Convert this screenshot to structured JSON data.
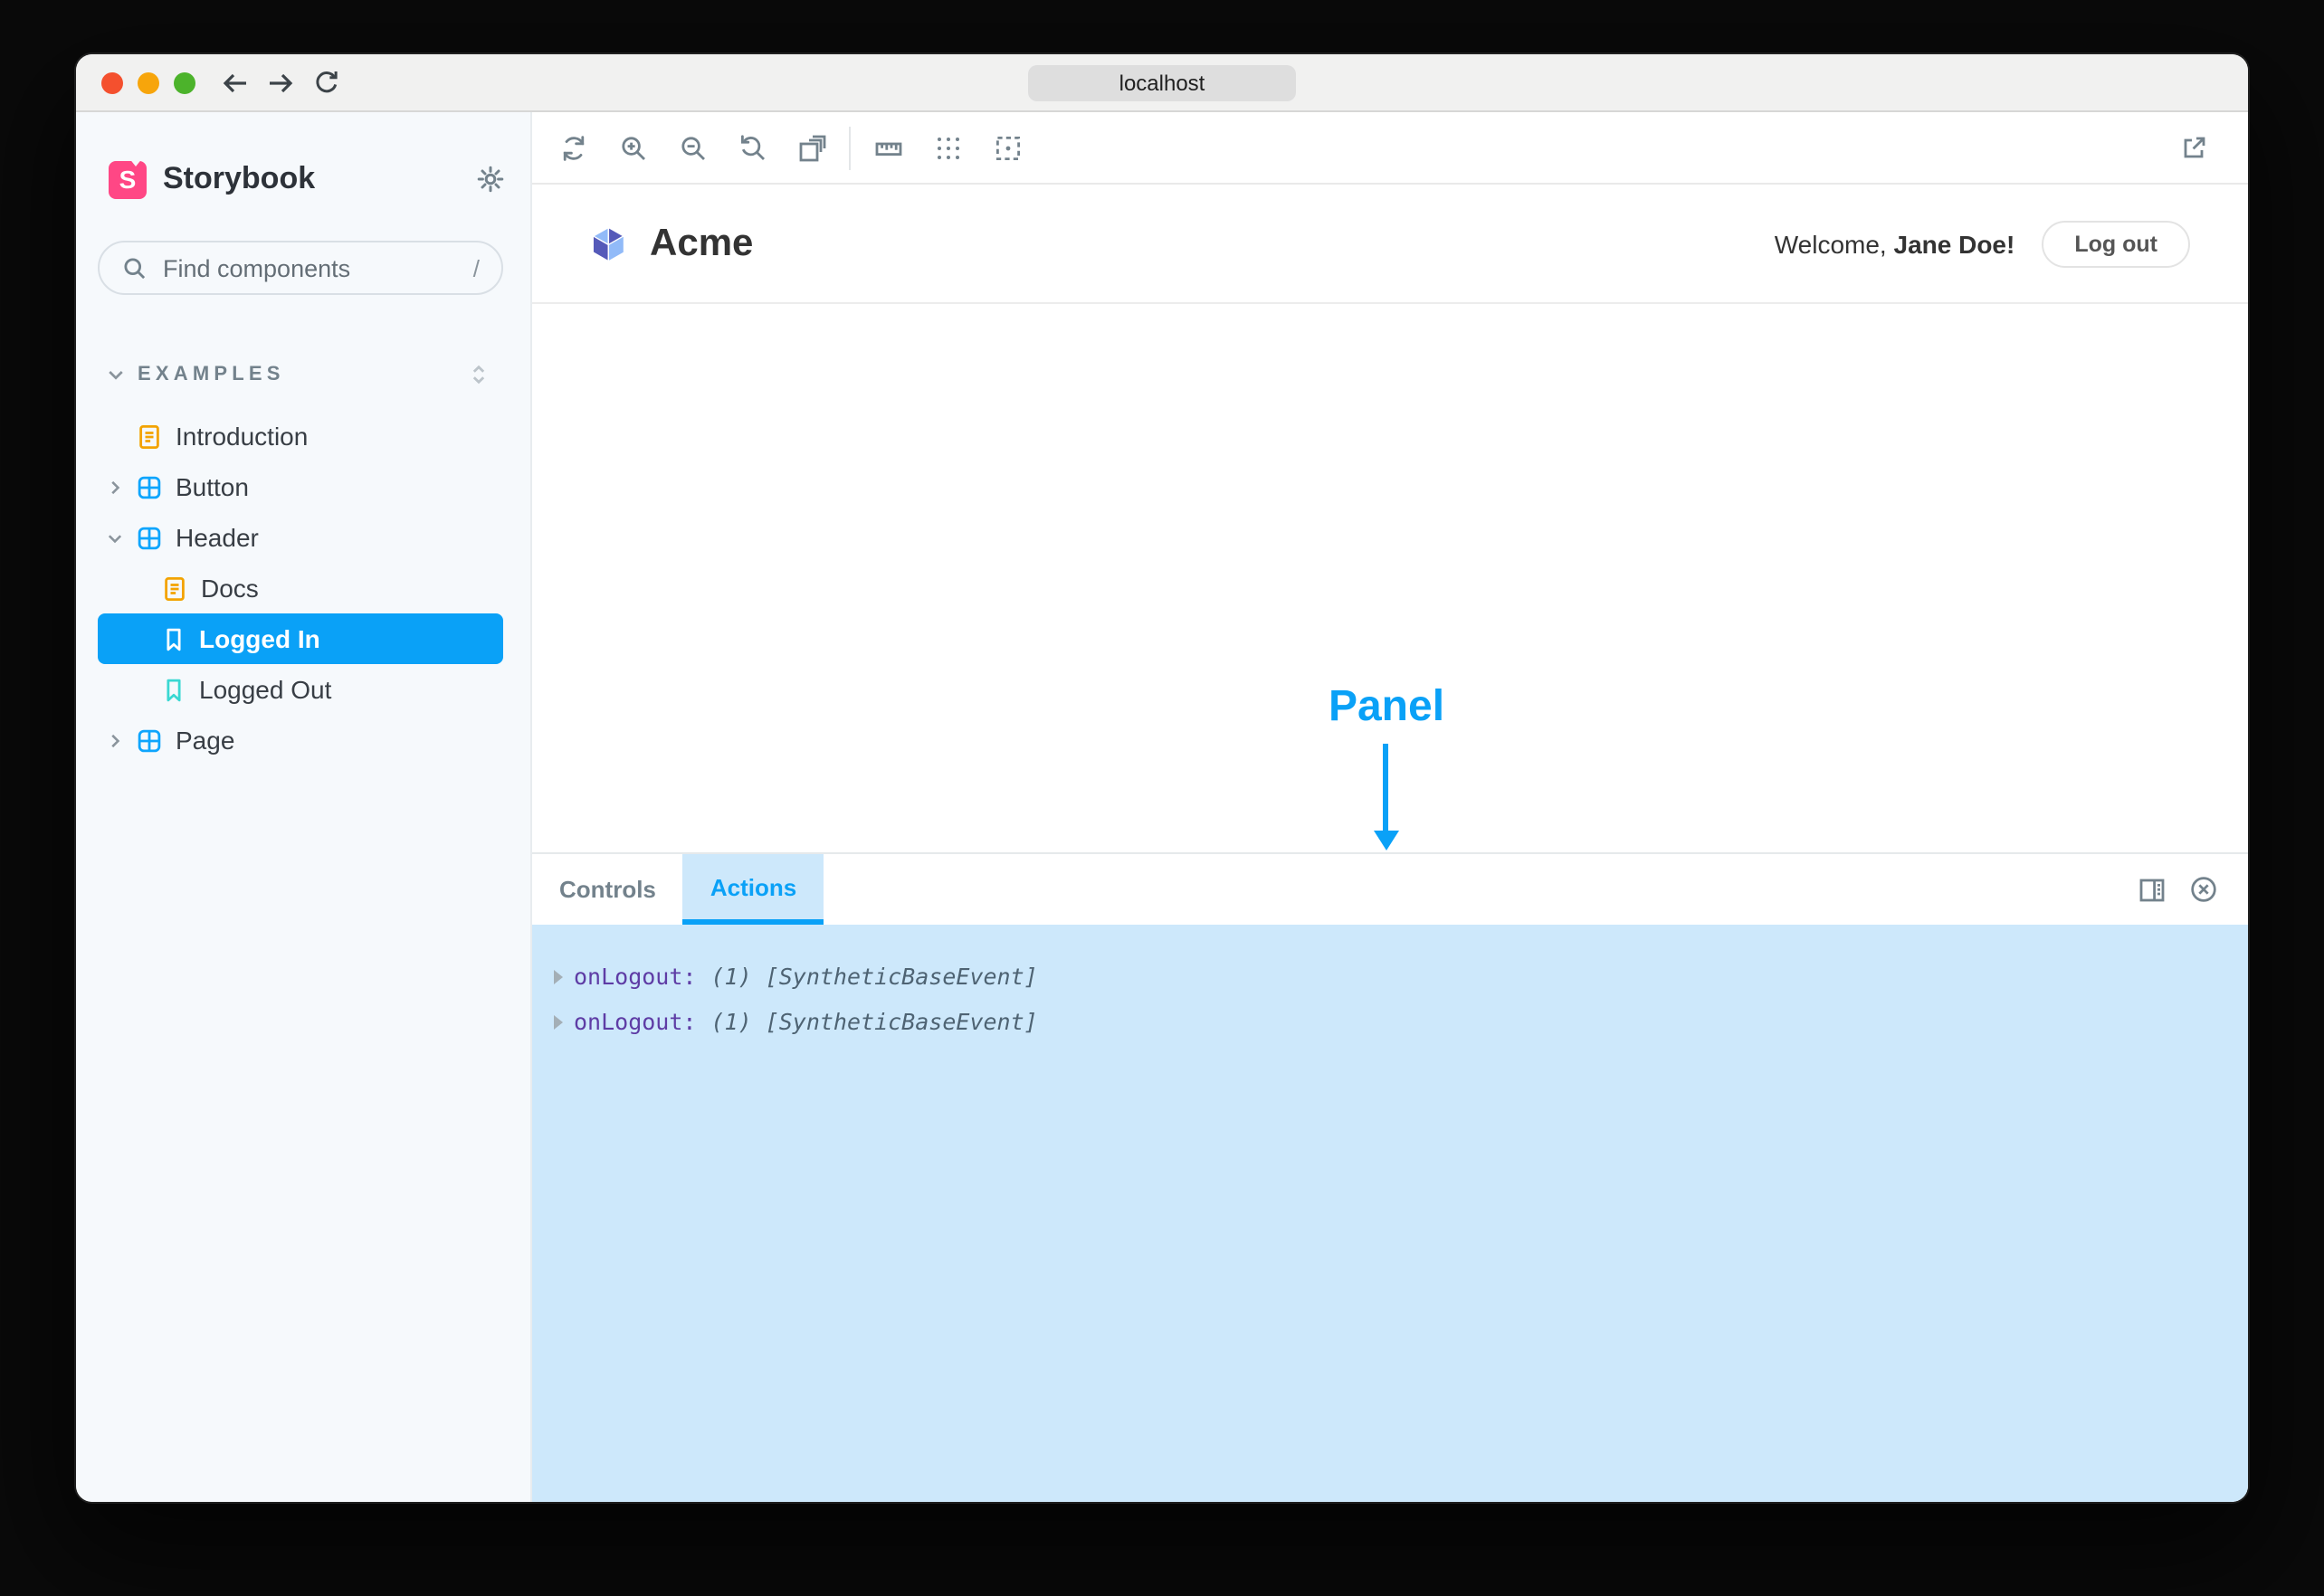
{
  "browser": {
    "url": "localhost",
    "traffic_lights": [
      "close-button",
      "minimize-button",
      "zoom-button"
    ],
    "nav": {
      "back": "back-arrow-icon",
      "forward": "forward-arrow-icon",
      "reload": "reload-icon"
    }
  },
  "sidebar": {
    "brand": {
      "title": "Storybook",
      "logo_letter": "S",
      "settings_icon": "gear-icon"
    },
    "search": {
      "placeholder": "Find components",
      "shortcut": "/",
      "icon": "search-icon"
    },
    "section": {
      "label": "EXAMPLES",
      "collapse_icon": "chevron-down-icon",
      "expander_icon": "expand-collapse-all-icon"
    },
    "tree": [
      {
        "label": "Introduction",
        "kind": "doc",
        "depth": 1,
        "selected": false
      },
      {
        "label": "Button",
        "kind": "component",
        "depth": 1,
        "collapsed": true,
        "selected": false
      },
      {
        "label": "Header",
        "kind": "component",
        "depth": 1,
        "expanded": true,
        "selected": false
      },
      {
        "label": "Docs",
        "kind": "doc",
        "depth": 2,
        "selected": false
      },
      {
        "label": "Logged In",
        "kind": "story",
        "depth": 2,
        "selected": true
      },
      {
        "label": "Logged Out",
        "kind": "story",
        "depth": 2,
        "selected": false
      },
      {
        "label": "Page",
        "kind": "component",
        "depth": 1,
        "collapsed": true,
        "selected": false
      }
    ]
  },
  "toolbar": {
    "icons": [
      "remount-icon",
      "zoom-in-icon",
      "zoom-out-icon",
      "zoom-reset-icon",
      "background-icon",
      "measure-icon",
      "grid-icon",
      "outline-icon"
    ],
    "open_external_icon": "open-canvas-new-tab-icon"
  },
  "preview": {
    "brand": "Acme",
    "welcome_prefix": "Welcome, ",
    "user": "Jane Doe!",
    "logout_label": "Log out"
  },
  "annotation": {
    "label": "Panel"
  },
  "panel": {
    "tabs": [
      {
        "label": "Controls",
        "active": false
      },
      {
        "label": "Actions",
        "active": true
      }
    ],
    "right_icons": [
      "panel-position-icon",
      "close-panel-icon"
    ],
    "rows": [
      {
        "name": "onLogout:",
        "value": "(1) [SyntheticBaseEvent]"
      },
      {
        "name": "onLogout:",
        "value": "(1) [SyntheticBaseEvent]"
      }
    ]
  },
  "colors": {
    "accent_blue": "#0AA1F7",
    "highlight_blue": "#CDE8FB",
    "brand_pink": "#FF4785",
    "docs_amber": "#F3A300",
    "story_teal": "#3AD8D2",
    "component_blue": "#0EA5FD",
    "sidebar_bg": "#F6F9FC"
  }
}
